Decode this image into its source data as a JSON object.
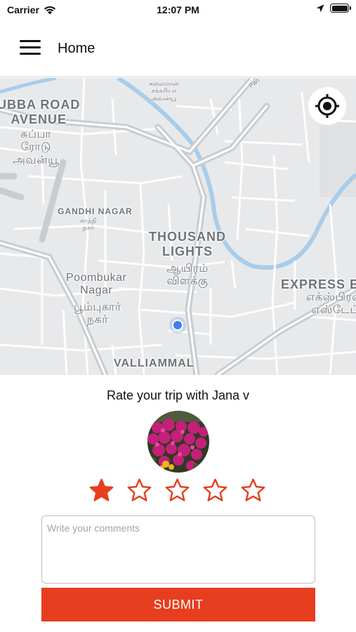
{
  "status_bar": {
    "carrier": "Carrier",
    "time": "12:07 PM"
  },
  "header": {
    "title": "Home",
    "menu_icon": "hamburger-menu-icon"
  },
  "map": {
    "labels": {
      "subba_road": "UBBA ROAD\nAVENUE",
      "subba_tamil": "சுப்பா\nரோடு\nஅவன்யூ",
      "sulaiman": "சுலைமான்\nசக்கரியா\nஅவன்யூ",
      "road_pan": "Pan",
      "gandhi_nagar": "GANDHI NAGAR",
      "gandhi_tamil": "காந்தி\nநகர்",
      "thousand_lights": "THOUSAND\nLIGHTS",
      "thousand_tamil": "ஆயிரம்\nவிளக்கு",
      "poombukar": "Poombukar\nNagar",
      "poombukar_tamil": "பூம்புகார்\nநகர்",
      "express": "EXPRESS E",
      "express_tamil": "எக்ஸ்பிரஸ்\nஎஸ்டேட்",
      "valliammal": "VALLIAMMAL"
    },
    "locate_icon": "my-location-icon",
    "colors": {
      "background": "#e8e9eb",
      "road": "#ffffff",
      "river": "#a8cdea",
      "user_location": "#3f7fe8"
    }
  },
  "rating": {
    "title": "Rate your trip with Jana v",
    "stars_selected": 1,
    "stars_total": 5,
    "comment_placeholder": "Write your comments",
    "comment_value": "",
    "submit_label": "SUBMIT",
    "accent_color": "#e63e1e"
  }
}
